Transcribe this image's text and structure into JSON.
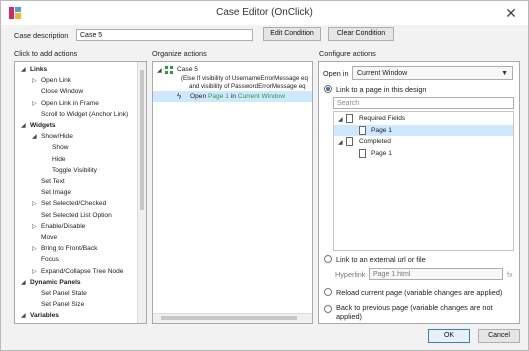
{
  "window": {
    "title": "Case Editor (OnClick)",
    "close_glyph": "✕"
  },
  "case_description": {
    "label": "Case description",
    "value": "Case 5",
    "edit_condition": "Edit Condition",
    "clear_condition": "Clear Condition"
  },
  "left_panel": {
    "header": "Click to add actions",
    "items": [
      {
        "label": "Links",
        "bold": true,
        "expander": "◢"
      },
      {
        "label": "Open Link",
        "expander": "▷"
      },
      {
        "label": "Close Window"
      },
      {
        "label": "Open Link in Frame",
        "expander": "▷"
      },
      {
        "label": "Scroll to Widget (Anchor Link)"
      },
      {
        "label": "Widgets",
        "bold": true,
        "expander": "◢"
      },
      {
        "label": "Show/Hide",
        "expander": "◢"
      },
      {
        "label": "Show"
      },
      {
        "label": "Hide"
      },
      {
        "label": "Toggle Visibility"
      },
      {
        "label": "Set Text"
      },
      {
        "label": "Set Image"
      },
      {
        "label": "Set Selected/Checked",
        "expander": "▷"
      },
      {
        "label": "Set Selected List Option"
      },
      {
        "label": "Enable/Disable",
        "expander": "▷"
      },
      {
        "label": "Move"
      },
      {
        "label": "Bring to Front/Back",
        "expander": "▷"
      },
      {
        "label": "Focus"
      },
      {
        "label": "Expand/Collapse Tree Node",
        "expander": "▷"
      },
      {
        "label": "Dynamic Panels",
        "bold": true,
        "expander": "◢"
      },
      {
        "label": "Set Panel State"
      },
      {
        "label": "Set Panel Size"
      },
      {
        "label": "Variables",
        "bold": true,
        "expander": "◢"
      }
    ]
  },
  "middle_panel": {
    "header": "Organize actions",
    "case_label": "Case 5",
    "condition_line1": "(Else If visibility of UsernameErrorMessage eq",
    "condition_line2": "and visibility of PasswordErrorMessage eq",
    "action_prefix": "Open",
    "action_page": "Page 1",
    "action_in": "in",
    "action_target": "Current Window"
  },
  "right_panel": {
    "header": "Configure actions",
    "open_in_label": "Open in",
    "open_in_value": "Current Window",
    "link_page_option": "Link to a page in this design",
    "search_placeholder": "Search",
    "tree": [
      {
        "label": "Required Fields",
        "type": "folder"
      },
      {
        "label": "Page 1",
        "type": "page",
        "selected": true
      },
      {
        "label": "Completed",
        "type": "folder"
      },
      {
        "label": "Page 1",
        "type": "page",
        "selected": false
      }
    ],
    "external_option": "Link to an external url or file",
    "hyperlink_label": "Hyperlink",
    "hyperlink_value": "Page 1.html",
    "fx_label": "fx",
    "reload_option": "Reload current page (variable changes are applied)",
    "back_option_line1": "Back to previous page (variable changes are not",
    "back_option_line2": "applied)"
  },
  "footer": {
    "ok": "OK",
    "cancel": "Cancel"
  },
  "colors": {
    "selected_row": "#cde8ff",
    "green_text": "#2e9a3c",
    "accent": "#3c7fb1"
  }
}
